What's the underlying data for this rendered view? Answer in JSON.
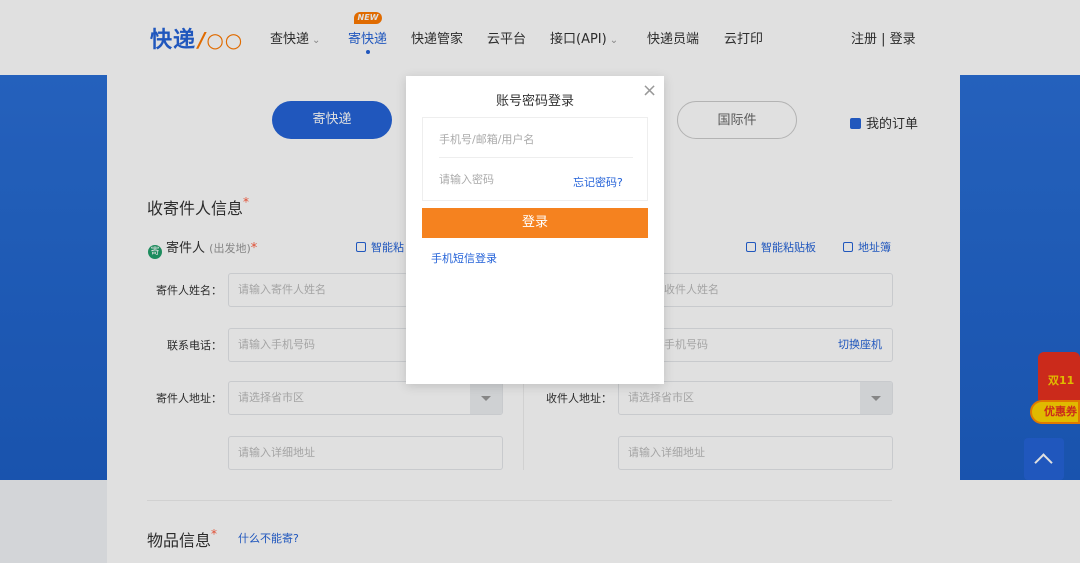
{
  "header": {
    "logo_text": "快递",
    "logo_mark": "/○○",
    "nav": [
      {
        "label": "查快递",
        "chevron": "⌄"
      },
      {
        "label": "寄快递",
        "badge": "NEW"
      },
      {
        "label": "快递管家"
      },
      {
        "label": "云平台"
      },
      {
        "label": "接口(API)",
        "chevron": "⌄"
      },
      {
        "label": "快递员端"
      },
      {
        "label": "云打印"
      }
    ],
    "auth_link": "注册 | 登录"
  },
  "send": {
    "send_button": "寄快递",
    "international_button": "国际件",
    "my_orders": "我的订单"
  },
  "contacts": {
    "title": "收寄件人信息",
    "required_mark": "*",
    "sender_pin": "寄",
    "sender_label": "寄件人",
    "sender_sub": "(出发地)",
    "smart_paste_sender": "智能粘",
    "smart_paste_receiver": "智能粘贴板",
    "address_book": "地址簿",
    "sender_name_label": "寄件人姓名：",
    "sender_name_placeholder": "请输入寄件人姓名",
    "phone_label": "联系电话：",
    "phone_placeholder": "请输入手机号码",
    "sender_address_label": "寄件人地址：",
    "region_placeholder": "请选择省市区",
    "detail_placeholder": "请输入详细地址",
    "receiver_name_partial": "收件人姓名",
    "receiver_phone_partial": "手机号码",
    "switch_landline": "切换座机",
    "receiver_address_label": "收件人地址："
  },
  "goods": {
    "title": "物品信息",
    "required_mark": "*",
    "prohibited_link": "什么不能寄?"
  },
  "login_modal": {
    "title": "账号密码登录",
    "close": "×",
    "account_placeholder": "手机号/邮箱/用户名",
    "password_placeholder": "请输入密码",
    "forgot": "忘记密码?",
    "login_button": "登录",
    "sms_login": "手机短信登录"
  },
  "promo": {
    "double11": "双11",
    "coupon": "优惠券"
  },
  "colors": {
    "brand_blue": "#2563d8",
    "accent_orange": "#f5821f",
    "required_red": "#ff5a3c"
  }
}
